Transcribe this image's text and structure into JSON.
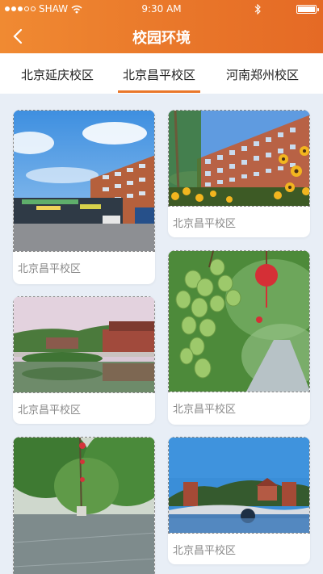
{
  "status_bar": {
    "carrier": "SHAW",
    "time": "9:30 AM"
  },
  "header": {
    "title": "校园环境"
  },
  "tabs": [
    {
      "label": "北京延庆校区",
      "active": false
    },
    {
      "label": "北京昌平校区",
      "active": true
    },
    {
      "label": "河南郑州校区",
      "active": false
    }
  ],
  "cards": [
    {
      "caption": "北京昌平校区",
      "scene": "school-building-parking"
    },
    {
      "caption": "北京昌平校区",
      "scene": "school-building-flowers"
    },
    {
      "caption": "北京昌平校区",
      "scene": "pond-pavilion"
    },
    {
      "caption": "北京昌平校区",
      "scene": "grapes-lantern"
    },
    {
      "caption": "",
      "scene": "trees-plaza"
    },
    {
      "caption": "北京昌平校区",
      "scene": "lake-pavilion"
    }
  ],
  "colors": {
    "accent": "#e9772a",
    "background": "#e8eef6",
    "caption": "#8a8a8a"
  },
  "icons": {
    "back": "back-arrow-icon",
    "wifi": "wifi-icon",
    "bluetooth": "bluetooth-icon",
    "battery": "battery-icon"
  }
}
